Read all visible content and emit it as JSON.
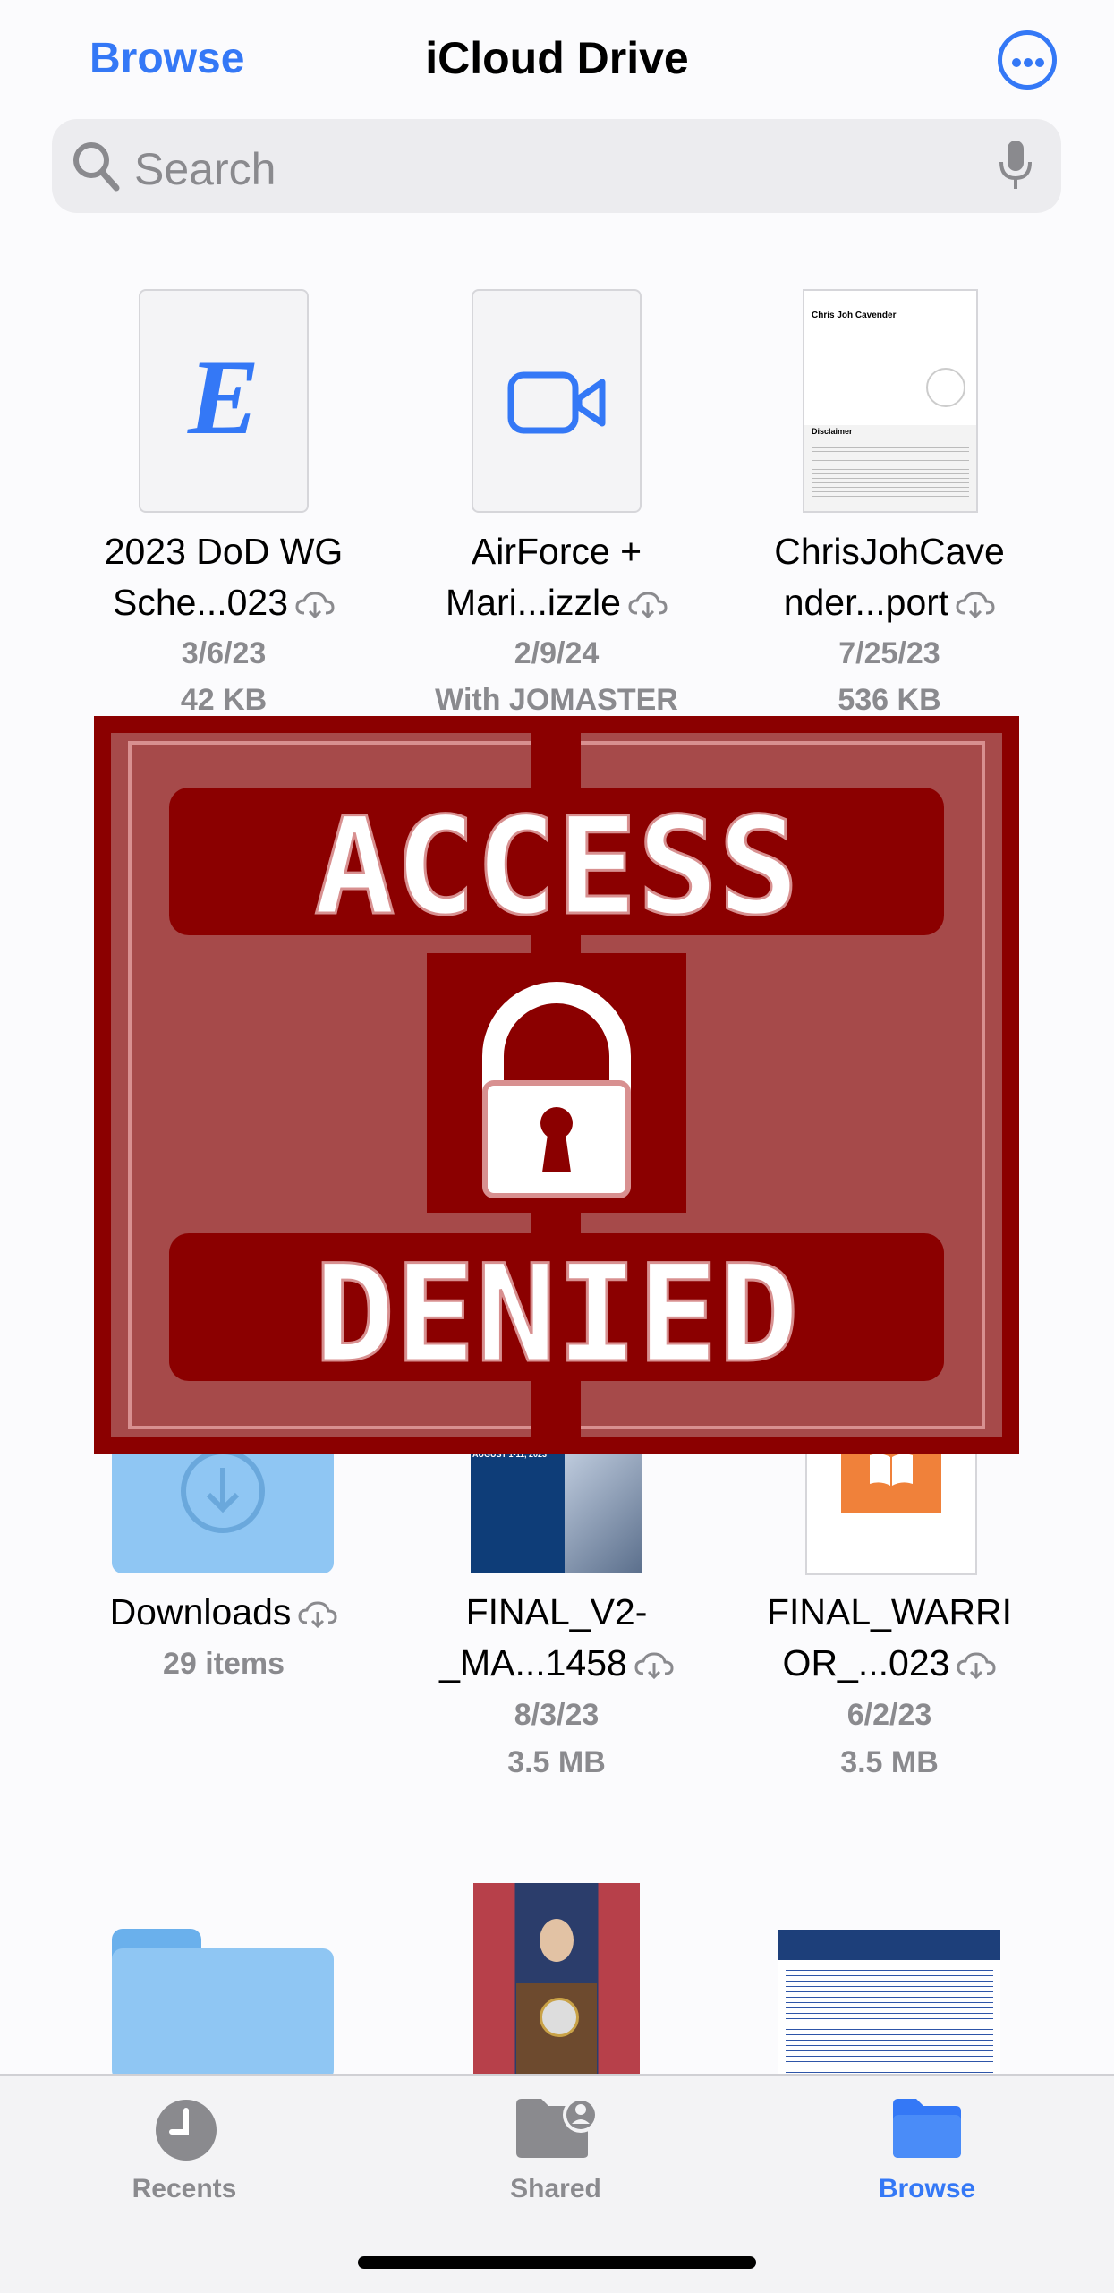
{
  "header": {
    "back_label": "Browse",
    "title": "iCloud Drive",
    "more_icon": "ellipsis-circle-icon"
  },
  "search": {
    "placeholder": "Search"
  },
  "files": [
    {
      "name_line1": "2023 DoD WG",
      "name_line2": "Sche...023",
      "date": "3/6/23",
      "detail": "42 KB"
    },
    {
      "name_line1": "AirForce +",
      "name_line2": "Mari...izzle",
      "date": "2/9/24",
      "detail": "With JOMASTER"
    },
    {
      "name_line1": "ChrisJohCave",
      "name_line2": "nder...port",
      "date": "7/25/23",
      "detail": "536 KB",
      "preview_title": "Chris Joh Cavender",
      "preview_section": "Disclaimer"
    },
    {
      "name_line1": "Downloads",
      "detail": "29 items"
    },
    {
      "name_line1": "FINAL_V2-",
      "name_line2": "_MA...1458",
      "date": "8/3/23",
      "detail": "3.5 MB",
      "preview_banner": "AUGUST 1-11, 2023"
    },
    {
      "name_line1": "FINAL_WARRI",
      "name_line2": "OR_...023",
      "date": "6/2/23",
      "detail": "3.5 MB"
    }
  ],
  "overlay": {
    "line1": "ACCESS",
    "line2": "DENIED",
    "icon": "padlock-icon"
  },
  "tabs": [
    {
      "label": "Recents",
      "icon": "clock-icon",
      "active": false
    },
    {
      "label": "Shared",
      "icon": "shared-folder-icon",
      "active": false
    },
    {
      "label": "Browse",
      "icon": "folder-icon",
      "active": true
    }
  ],
  "colors": {
    "accent": "#3478f6",
    "secondary_text": "#8a8a8e",
    "overlay_red": "#8b0000"
  }
}
